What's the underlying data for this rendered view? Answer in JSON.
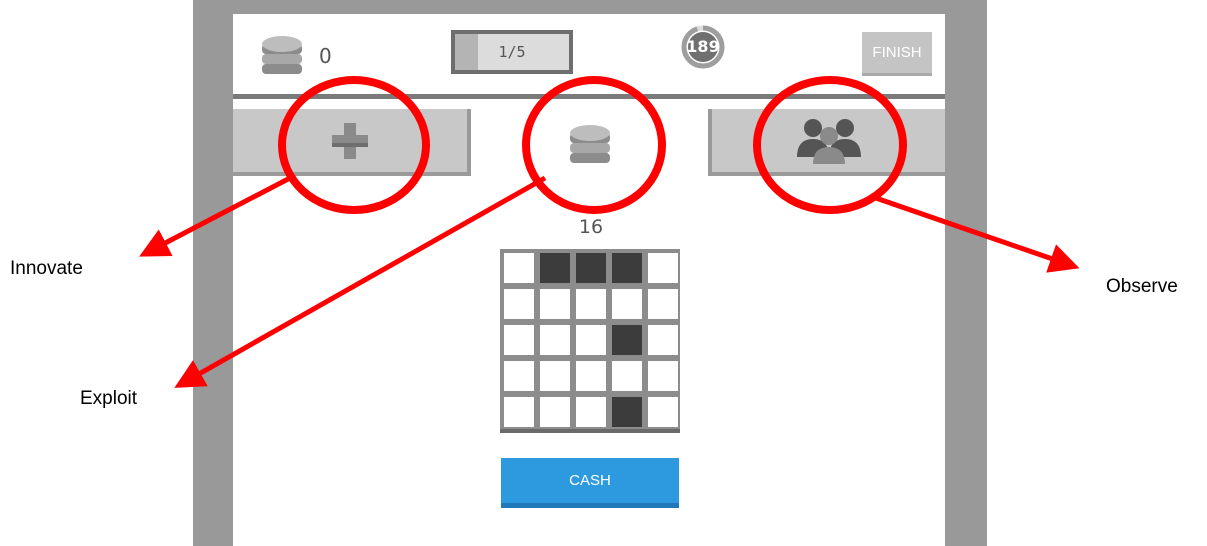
{
  "header": {
    "coins_icon": "coin-stack-icon",
    "coins": "0",
    "round_text": "1/5",
    "round_progress": 0.2,
    "timer_value": "189",
    "timer_progress": 0.95,
    "finish_label": "FINISH"
  },
  "tabs": [
    {
      "name": "innovate",
      "icon": "plus-icon",
      "active": false
    },
    {
      "name": "exploit",
      "icon": "coin-stack-icon",
      "active": true
    },
    {
      "name": "observe",
      "icon": "group-icon",
      "active": false
    }
  ],
  "main": {
    "score": "16",
    "grid": [
      [
        0,
        1,
        1,
        1,
        0
      ],
      [
        0,
        0,
        0,
        0,
        0
      ],
      [
        0,
        0,
        0,
        1,
        0
      ],
      [
        0,
        0,
        0,
        0,
        0
      ],
      [
        0,
        0,
        0,
        1,
        0
      ]
    ],
    "cash_label": "CASH"
  },
  "annotations": {
    "innovate": "Innovate",
    "exploit": "Exploit",
    "observe": "Observe"
  },
  "colors": {
    "accent_blue": "#2d9ae0",
    "annotation_red": "#ff0000",
    "filled_cell": "#3c3c3c",
    "empty_cell": "#ffffff",
    "frame_gray": "#999999"
  }
}
